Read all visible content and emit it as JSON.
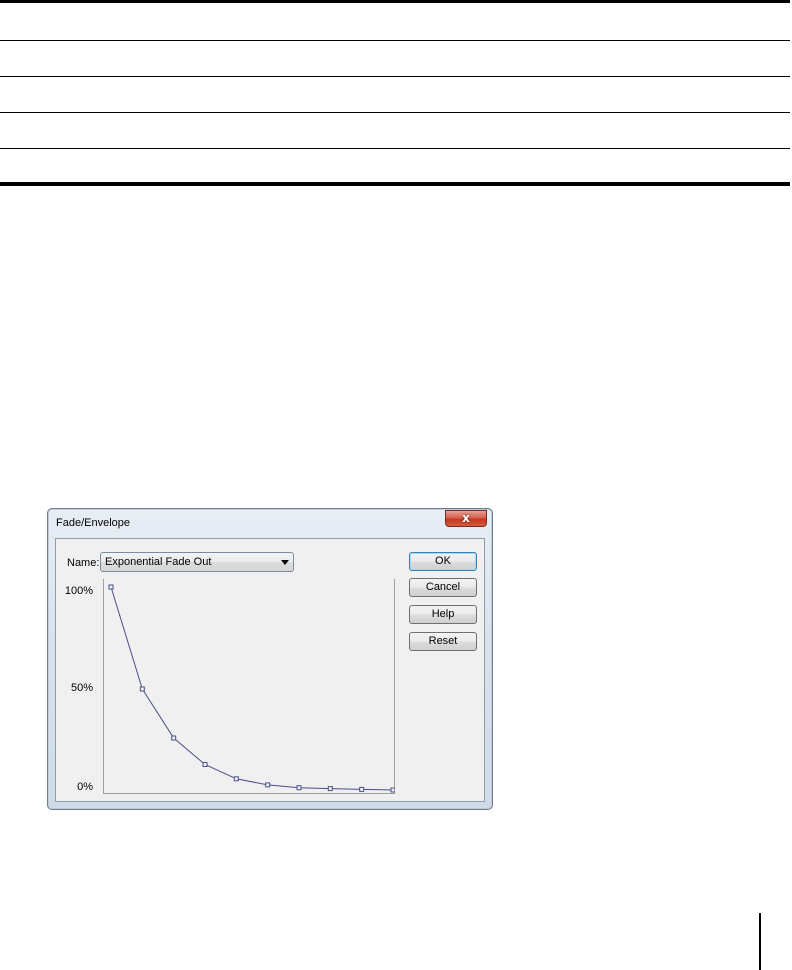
{
  "dialog": {
    "title": "Fade/Envelope",
    "close_symbol": "x",
    "name_label": "Name:",
    "name_value": "Exponential Fade Out",
    "buttons": {
      "ok": "OK",
      "cancel": "Cancel",
      "help": "Help",
      "reset": "Reset"
    }
  },
  "icons": {
    "close": "close-icon",
    "dropdown": "chevron-down-icon"
  },
  "chart_data": {
    "type": "line",
    "y_ticks": [
      "100%",
      "50%",
      "0%"
    ],
    "ylim": [
      0,
      100
    ],
    "xlim": [
      0,
      9
    ],
    "x": [
      0,
      1,
      2,
      3,
      4,
      5,
      6,
      7,
      8,
      9
    ],
    "values": [
      100,
      50,
      26,
      13,
      6,
      3,
      1.6,
      1.2,
      0.8,
      0.5
    ],
    "line_color": "#4a4f8a",
    "marker_color": "#4a4f8a",
    "plot_background": "#f0f0f0",
    "frame_color": "#a0a0a0"
  }
}
